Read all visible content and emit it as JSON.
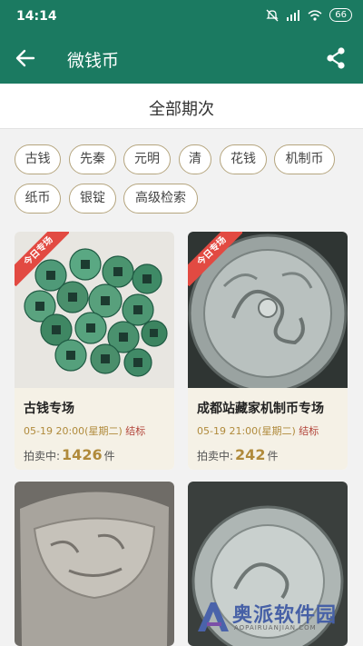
{
  "status_bar": {
    "time": "14:14",
    "battery": "66"
  },
  "app_bar": {
    "title": "微钱币"
  },
  "section": {
    "title": "全部期次"
  },
  "filters": [
    "古钱",
    "先秦",
    "元明",
    "清",
    "花钱",
    "机制币",
    "纸币",
    "银锭",
    "高级检索"
  ],
  "cards": [
    {
      "ribbon": "今日专场",
      "title": "古钱专场",
      "date": "05-19 20:00(星期二)",
      "state": "结标",
      "bid_label": "拍卖中:",
      "bid_count": "1426",
      "bid_unit": "件"
    },
    {
      "ribbon": "今日专场",
      "title": "成都站藏家机制币专场",
      "date": "05-19 21:00(星期二)",
      "state": "结标",
      "bid_label": "拍卖中:",
      "bid_count": "242",
      "bid_unit": "件"
    },
    {
      "ribbon": "",
      "title": "",
      "date": "",
      "state": "",
      "bid_label": "",
      "bid_count": "",
      "bid_unit": ""
    },
    {
      "ribbon": "",
      "title": "",
      "date": "",
      "state": "",
      "bid_label": "",
      "bid_count": "",
      "bid_unit": ""
    }
  ],
  "watermark": {
    "text": "奥派软件园",
    "sub": "AOPAIRUANJIAN.COM"
  },
  "colors": {
    "primary": "#1b7a61",
    "chip_border": "#b5a57e",
    "gold": "#b08a3b",
    "ribbon": "#e24a42"
  }
}
